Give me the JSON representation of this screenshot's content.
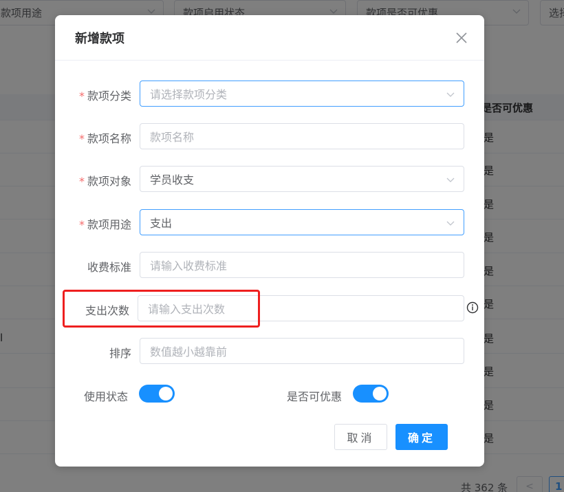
{
  "background": {
    "filters": [
      {
        "label": "款项用途"
      },
      {
        "label": "款项启用状态"
      },
      {
        "label": "款项是否可优惠"
      },
      {
        "label": "选择"
      }
    ],
    "table_header": "是否可优惠",
    "row_values": [
      "是",
      "是",
      "是",
      "是",
      "是",
      "是",
      "是",
      "是",
      "是",
      "是"
    ],
    "edge_text": "l",
    "total_text": "共 362 条",
    "page_prev": "<",
    "page_current": "1"
  },
  "dialog": {
    "title": "新增款项",
    "fields": {
      "category": {
        "label": "款项分类",
        "required": true,
        "value": "",
        "placeholder": "请选择款项分类"
      },
      "name": {
        "label": "款项名称",
        "required": true,
        "value": "",
        "placeholder": "款项名称"
      },
      "target": {
        "label": "款项对象",
        "required": true,
        "value": "学员收支",
        "placeholder": ""
      },
      "usage": {
        "label": "款项用途",
        "required": true,
        "value": "支出",
        "placeholder": ""
      },
      "fee_standard": {
        "label": "收费标准",
        "required": false,
        "value": "",
        "placeholder": "请输入收费标准"
      },
      "expense_count": {
        "label": "支出次数",
        "required": false,
        "value": "",
        "placeholder": "请输入支出次数"
      },
      "sort": {
        "label": "排序",
        "required": false,
        "value": "",
        "placeholder": "数值越小越靠前"
      }
    },
    "switches": {
      "status": {
        "label": "使用状态",
        "on": true
      },
      "discount": {
        "label": "是否可优惠",
        "on": true
      }
    },
    "buttons": {
      "cancel": "取消",
      "confirm": "确定"
    },
    "required_mark": "*"
  },
  "colors": {
    "primary": "#1890ff",
    "highlight_box": "#ee1f1f",
    "required": "#f56c6c"
  }
}
